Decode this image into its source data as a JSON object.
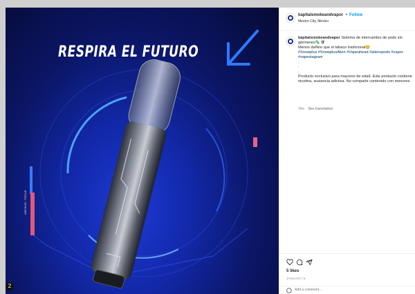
{
  "post": {
    "headline": "RESPIRA EL FUTURO",
    "side_label": "ARCHIVE · FOCUS",
    "media_badge": "2"
  },
  "header": {
    "username": "kapitalsmokeandvapor",
    "separator": "•",
    "follow_label": "Follow",
    "location": "Mexico City, Mexico"
  },
  "caption": {
    "username": "kapitalsmokeandvapor",
    "line1": "Sistema de intercambio de pods sin gérmenes🦠🛡",
    "line2": "Menos dañino que el tabaco tradicional😊",
    "hashtags": "#Snowplus #SnowplusAlien #Vapeahead #alienxpods #vapor",
    "hashtags2": "#vapestagram",
    "dots": [
      ".",
      ".",
      "."
    ],
    "disclaimer": "Producto exclusivo para mayores de edad. Este producto contiene nicotina, sustancia adictiva. No compartir contenido con menores.",
    "age": "39w",
    "see_translation": "See translation"
  },
  "actions": {
    "likes": "5 likes",
    "date": "JANUARY 9",
    "comment_placeholder": "Add a comment..."
  },
  "icons": [
    "heart-icon",
    "comment-icon",
    "share-icon",
    "emoji-icon",
    "arrow-icon"
  ],
  "colors": {
    "accent": "#0095f6",
    "tag": "#00376b",
    "bg_dark": "#0b1666",
    "ring": "#3b7bff"
  }
}
